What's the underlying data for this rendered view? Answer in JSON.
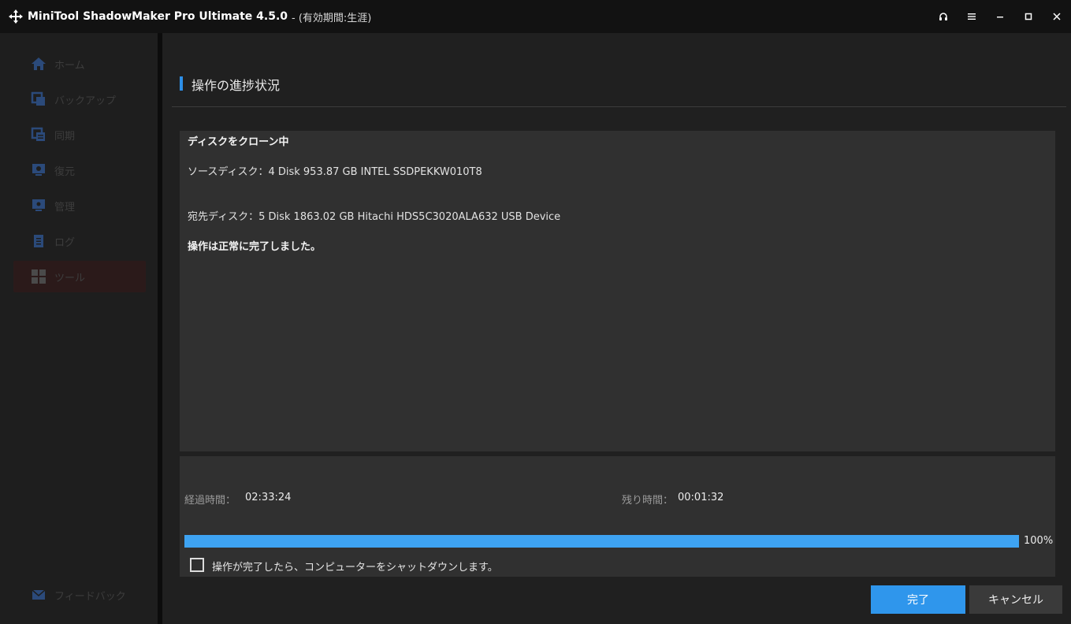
{
  "window": {
    "title": "MiniTool ShadowMaker Pro Ultimate 4.5.0",
    "subtitle": "- (有効期間:生涯)",
    "controls": [
      "headset-icon",
      "menu-icon",
      "minimize-icon",
      "maximize-icon",
      "close-icon"
    ]
  },
  "sidebar": {
    "items": [
      {
        "label": "ホーム",
        "icon": "home-icon"
      },
      {
        "label": "バックアップ",
        "icon": "backup-icon"
      },
      {
        "label": "同期",
        "icon": "sync-icon"
      },
      {
        "label": "復元",
        "icon": "restore-icon"
      },
      {
        "label": "管理",
        "icon": "manage-icon"
      },
      {
        "label": "ログ",
        "icon": "log-icon"
      },
      {
        "label": "ツール",
        "icon": "tools-icon",
        "active": true
      }
    ],
    "feedback": {
      "label": "フィードバック",
      "icon": "mail-icon"
    }
  },
  "main": {
    "section_title": "操作の進捗状況",
    "log": {
      "status": "ディスクをクローン中",
      "source": "ソースディスク：4 Disk 953.87 GB INTEL SSDPEKKW010T8",
      "destination": "宛先ディスク：5 Disk 1863.02 GB Hitachi HDS5C3020ALA632 USB Device",
      "result": "操作は正常に完了しました。"
    },
    "progress": {
      "elapsed_label": "経過時間：",
      "elapsed_value": "02:33:24",
      "remaining_label": "残り時間：",
      "remaining_value": "00:01:32",
      "percent": 100,
      "percent_text": "100%",
      "shutdown_label": "操作が完了したら、コンピューターをシャットダウンします。",
      "shutdown_checked": false
    },
    "buttons": {
      "finish": "完了",
      "cancel": "キャンセル"
    }
  },
  "colors": {
    "accent": "#2f96ec",
    "progress_fill": "#3ea3f2",
    "background": "#202020",
    "panel": "#303030"
  }
}
